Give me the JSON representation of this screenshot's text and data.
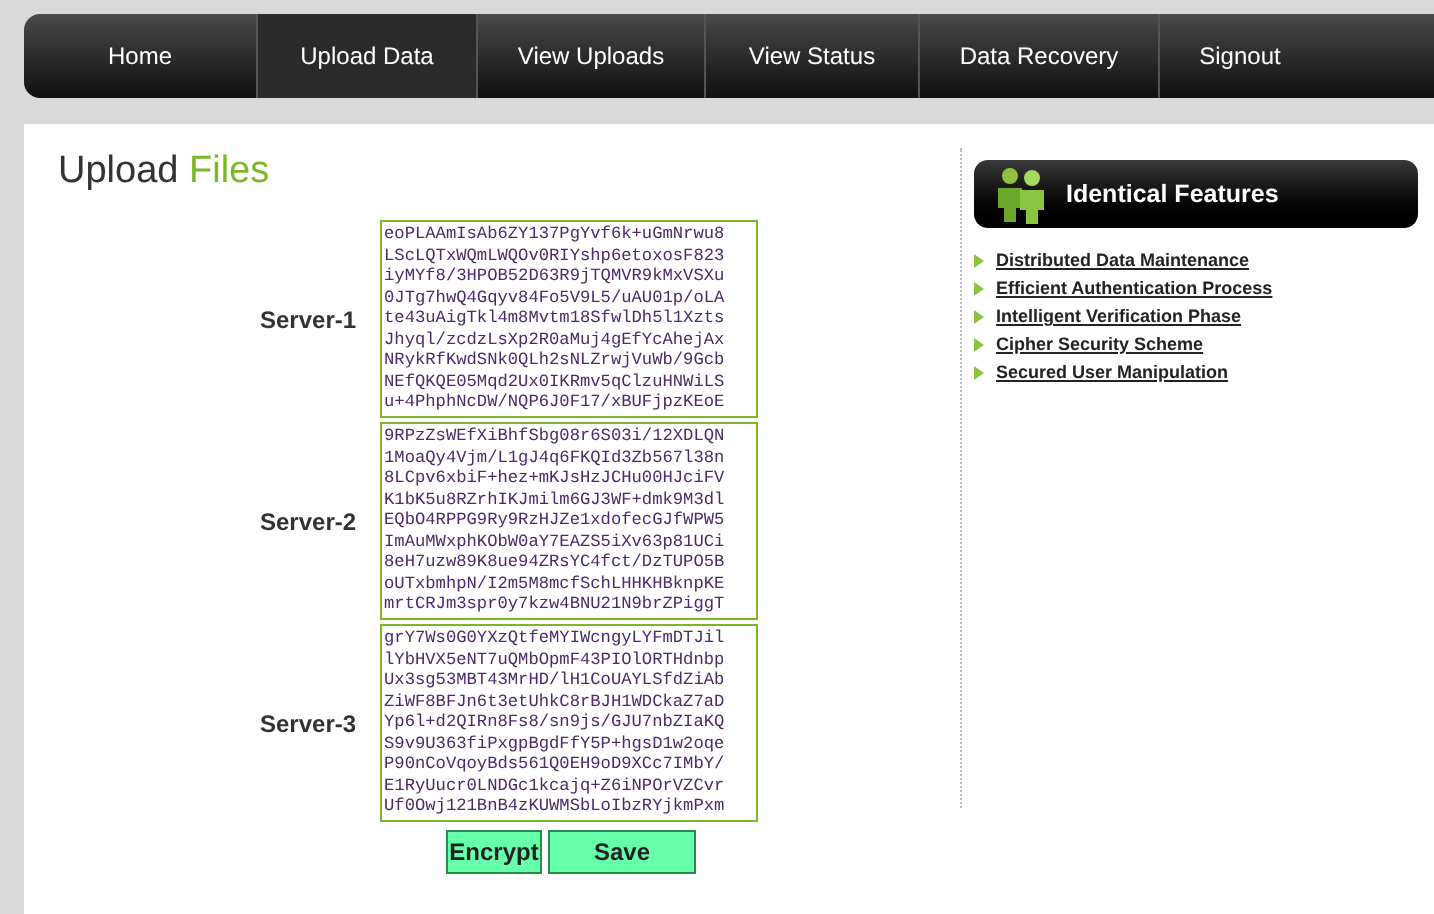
{
  "nav": [
    {
      "label": "Home",
      "selected": false
    },
    {
      "label": "Upload Data",
      "selected": true
    },
    {
      "label": "View Uploads",
      "selected": false
    },
    {
      "label": "View Status",
      "selected": false
    },
    {
      "label": "Data Recovery",
      "selected": false
    },
    {
      "label": "Signout",
      "selected": false
    }
  ],
  "page_title": {
    "first": "Upload",
    "second": "Files"
  },
  "servers": [
    {
      "label": "Server-1",
      "value": "eoPLAAmIsAb6ZY137PgYvf6k+uGmNrwu8\nLScLQTxWQmLWQOv0RIYshp6etoxosF823\niyMYf8/3HPOB52D63R9jTQMVR9kMxVSXu\n0JTg7hwQ4Gqyv84Fo5V9L5/uAU01p/oLA\nte43uAigTkl4m8Mvtm18SfwlDh5l1Xzts\nJhyql/zcdzLsXp2R0aMuj4gEfYcAhejAx\nNRykRfKwdSNk0QLh2sNLZrwjVuWb/9Gcb\nNEfQKQE05Mqd2Ux0IKRmv5qClzuHNWiLS\nu+4PhphNcDW/NQP6J0F17/xBUFjpzKEoE"
    },
    {
      "label": "Server-2",
      "value": "9RPzZsWEfXiBhfSbg08r6S03i/12XDLQN\n1MoaQy4Vjm/L1gJ4q6FKQId3Zb567l38n\n8LCpv6xbiF+hez+mKJsHzJCHu00HJciFV\nK1bK5u8RZrhIKJmilm6GJ3WF+dmk9M3dl\nEQbO4RPPG9Ry9RzHJZe1xdofecGJfWPW5\nImAuMWxphKObW0aY7EAZS5iXv63p81UCi\n8eH7uzw89K8ue94ZRsYC4fct/DzTUPO5B\noUTxbmhpN/I2m5M8mcfSchLHHKHBknpKE\nmrtCRJm3spr0y7kzw4BNU21N9brZPiggT"
    },
    {
      "label": "Server-3",
      "value": "grY7Ws0G0YXzQtfeMYIWcngyLYFmDTJil\nlYbHVX5eNT7uQMbOpmF43PIOlORTHdnbp\nUx3sg53MBT43MrHD/lH1CoUAYLSfdZiAb\nZiWF8BFJn6t3etUhkC8rBJH1WDCkaZ7aD\nYp6l+d2QIRn8Fs8/sn9js/GJU7nbZIaKQ\nS9v9U363fiPxgpBgdFfY5P+hgsD1w2oqe\nP90nCoVqoyBds561Q0EH9oD9XCc7IMbY/\nE1RyUucr0LNDGc1kcajq+Z6iNPOrVZCvr\nUf0Owj121BnB4zKUWMSbLoIbzRYjkmPxm"
    }
  ],
  "buttons": [
    "Encrypt",
    "Save"
  ],
  "sidebar": {
    "title": "Identical Features",
    "links": [
      "Distributed Data Maintenance",
      "Efficient Authentication Process",
      "Intelligent Verification Phase",
      "Cipher Security Scheme",
      "Secured User Manipulation"
    ]
  }
}
